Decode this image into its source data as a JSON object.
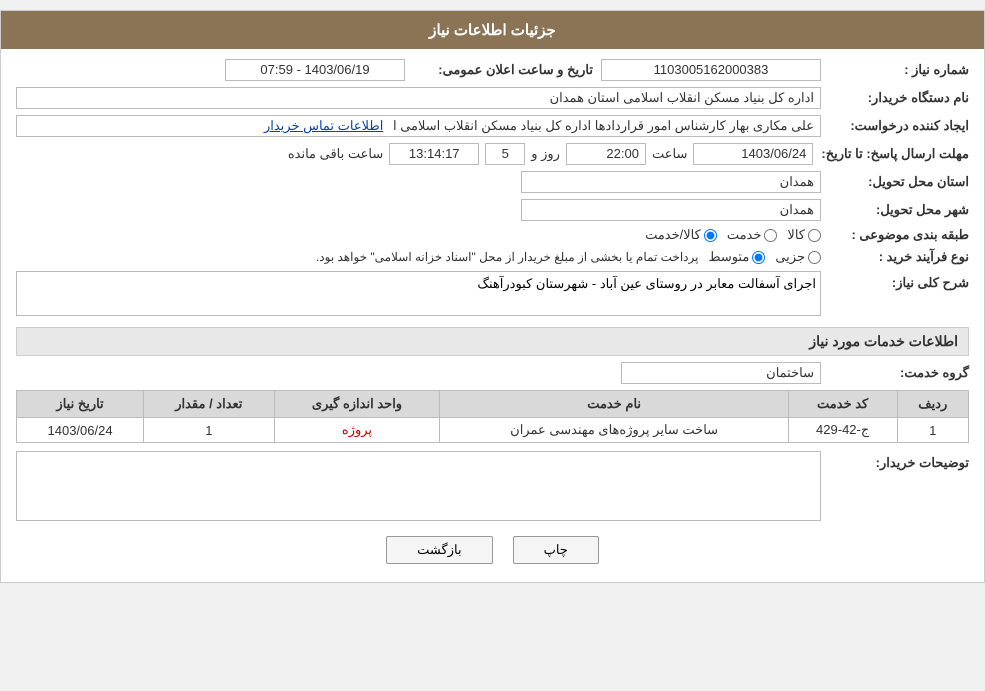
{
  "header": {
    "title": "جزئیات اطلاعات نیاز"
  },
  "fields": {
    "notice_number_label": "شماره نیاز :",
    "notice_number_value": "1103005162000383",
    "announce_datetime_label": "تاریخ و ساعت اعلان عمومی:",
    "announce_datetime_value": "1403/06/19 - 07:59",
    "buyer_org_label": "نام دستگاه خریدار:",
    "buyer_org_value": "اداره کل بنیاد مسکن انقلاب اسلامی استان همدان",
    "creator_label": "ایجاد کننده درخواست:",
    "creator_value": "علی مکاری بهار کارشناس امور قراردادها اداره کل بنیاد مسکن انقلاب اسلامی ا",
    "creator_link": "اطلاعات تماس خریدار",
    "deadline_label": "مهلت ارسال پاسخ: تا تاریخ:",
    "deadline_date": "1403/06/24",
    "deadline_time_label": "ساعت",
    "deadline_time": "22:00",
    "deadline_days_label": "روز و",
    "deadline_days": "5",
    "deadline_remaining_label": "ساعت باقی مانده",
    "deadline_remaining": "13:14:17",
    "province_label": "استان محل تحویل:",
    "province_value": "همدان",
    "city_label": "شهر محل تحویل:",
    "city_value": "همدان",
    "category_label": "طبقه بندی موضوعی :",
    "category_options": [
      {
        "label": "کالا",
        "value": "kala"
      },
      {
        "label": "خدمت",
        "value": "khedmat"
      },
      {
        "label": "کالا/خدمت",
        "value": "kala_khedmat"
      }
    ],
    "purchase_type_label": "نوع فرآیند خرید :",
    "purchase_type_options": [
      {
        "label": "جزیی",
        "value": "jozi"
      },
      {
        "label": "متوسط",
        "value": "motavaset"
      }
    ],
    "purchase_type_note": "پرداخت تمام یا بخشی از مبلغ خریدار از محل \"اسناد خزانه اسلامی\" خواهد بود.",
    "general_desc_label": "شرح کلی نیاز:",
    "general_desc_value": "اجرای آسفالت معابر در روستای عین آباد - شهرستان کبودرآهنگ",
    "services_section_label": "اطلاعات خدمات مورد نیاز",
    "service_group_label": "گروه خدمت:",
    "service_group_value": "ساختمان",
    "table": {
      "columns": [
        "ردیف",
        "کد خدمت",
        "نام خدمت",
        "واحد اندازه گیری",
        "تعداد / مقدار",
        "تاریخ نیاز"
      ],
      "rows": [
        {
          "row": "1",
          "code": "ج-42-429",
          "name": "ساخت سایر پروژه‌های مهندسی عمران",
          "unit": "پروژه",
          "qty": "1",
          "date": "1403/06/24"
        }
      ]
    },
    "buyer_notes_label": "توضیحات خریدار:",
    "buyer_notes_value": ""
  },
  "buttons": {
    "print_label": "چاپ",
    "back_label": "بازگشت"
  }
}
